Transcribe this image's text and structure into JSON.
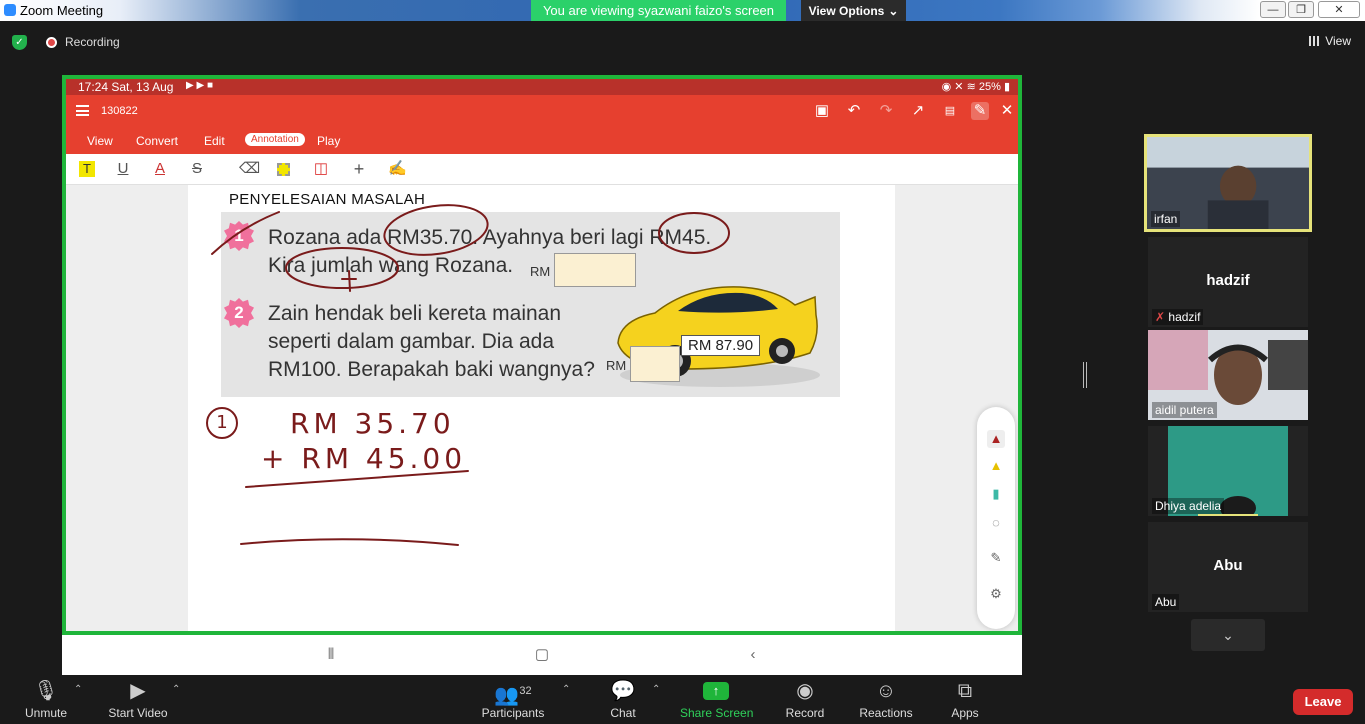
{
  "window": {
    "title": "Zoom Meeting",
    "viewing_banner": "You are viewing syazwani faizo's screen",
    "view_options": "View Options",
    "minimize": "—",
    "maximize": "❐",
    "close": "✕"
  },
  "topbar": {
    "recording_label": "Recording",
    "view_label": "View"
  },
  "shared_screen": {
    "status_time": "17:24  Sat, 13 Aug",
    "status_right": "25%",
    "doc_title": "130822",
    "menu": [
      "View",
      "Convert",
      "Edit",
      "Annotation",
      "Play"
    ],
    "active_menu": "Annotation",
    "page_heading": "PENYELESAIAN MASALAH",
    "q1_number": "1",
    "q1_line1": "Rozana ada RM35.70. Ayahnya beri lagi RM45.",
    "q1_line2": "Kira jumlah wang Rozana.",
    "q2_number": "2",
    "q2_line1": "Zain hendak beli kereta mainan",
    "q2_line2": "seperti dalam gambar. Dia ada",
    "q2_line3": "RM100. Berapakah baki wangnya?",
    "rm_label_1": "RM",
    "rm_label_2": "RM",
    "price_tag": "RM 87.90",
    "hand_number": "1",
    "hand_line1": "RM 35.70",
    "hand_line2": "+ RM 45.00"
  },
  "participants_panel": {
    "tiles": [
      {
        "name": "irfan",
        "type": "video"
      },
      {
        "name": "hadzif",
        "center": "hadzif",
        "muted": true
      },
      {
        "name": "aidil putera",
        "type": "video"
      },
      {
        "name": "Dhiya adelia",
        "type": "video"
      },
      {
        "name": "Abu",
        "center": "Abu"
      }
    ]
  },
  "controls": {
    "unmute": "Unmute",
    "start_video": "Start Video",
    "participants": "Participants",
    "participants_count": "32",
    "chat": "Chat",
    "share_screen": "Share Screen",
    "record": "Record",
    "reactions": "Reactions",
    "apps": "Apps",
    "leave": "Leave"
  },
  "colors": {
    "share_border": "#1fb53a",
    "app_header": "#e6402f",
    "leave": "#d42b2b",
    "active_speaker": "#e6e37a",
    "annotation_ink": "#7a1b1b"
  }
}
